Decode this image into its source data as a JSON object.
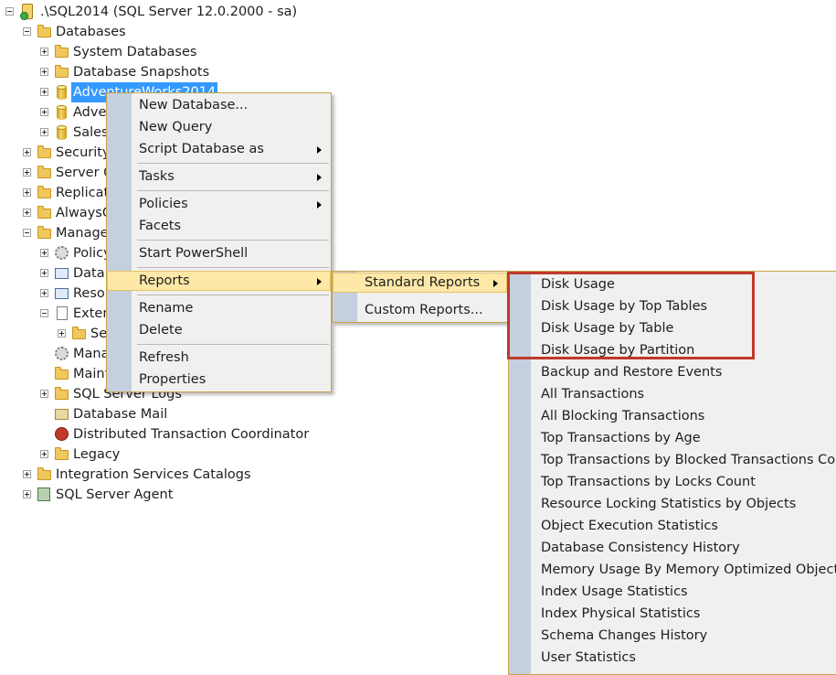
{
  "tree": {
    "server": ".\\SQL2014 (SQL Server 12.0.2000 - sa)",
    "databases": "Databases",
    "system_databases": "System Databases",
    "database_snapshots": "Database Snapshots",
    "adventureworks2014": "AdventureWorks2014",
    "adventure_2": "Adve",
    "sales": "Sales",
    "security": "Security",
    "server_objects": "Server O",
    "replication": "Replicat",
    "alwayson": "AlwaysO",
    "management": "Manage",
    "policy": "Policy",
    "data_collection": "Data",
    "resource_governor": "Resou",
    "extended_events": "Exten",
    "sessions": "Se",
    "maintenance_legacy": "Mana",
    "maintenance_plans": "Maint",
    "sql_server_logs": "SQL Server Logs",
    "database_mail": "Database Mail",
    "dtc": "Distributed Transaction Coordinator",
    "legacy": "Legacy",
    "integration_services": "Integration Services Catalogs",
    "sql_server_agent": "SQL Server Agent"
  },
  "context_menu": {
    "new_database": "New Database...",
    "new_query": "New Query",
    "script_database_as": "Script Database as",
    "tasks": "Tasks",
    "policies": "Policies",
    "facets": "Facets",
    "start_powershell": "Start PowerShell",
    "reports": "Reports",
    "rename": "Rename",
    "delete": "Delete",
    "refresh": "Refresh",
    "properties": "Properties"
  },
  "reports_menu": {
    "standard_reports": "Standard Reports",
    "custom_reports": "Custom Reports..."
  },
  "standard_reports": [
    "Disk Usage",
    "Disk Usage by Top Tables",
    "Disk Usage by Table",
    "Disk Usage by Partition",
    "Backup and Restore Events",
    "All Transactions",
    "All Blocking Transactions",
    "Top Transactions by Age",
    "Top Transactions by Blocked Transactions Count",
    "Top Transactions by Locks Count",
    "Resource Locking Statistics by Objects",
    "Object Execution Statistics",
    "Database Consistency History",
    "Memory Usage By Memory Optimized Objects",
    "Index Usage Statistics",
    "Index Physical Statistics",
    "Schema Changes History",
    "User Statistics"
  ],
  "colors": {
    "selection": "#3399ff",
    "menu_highlight": "#fde8a8",
    "menu_gutter": "#c4cfdf",
    "annotation_box": "#c0392b"
  }
}
